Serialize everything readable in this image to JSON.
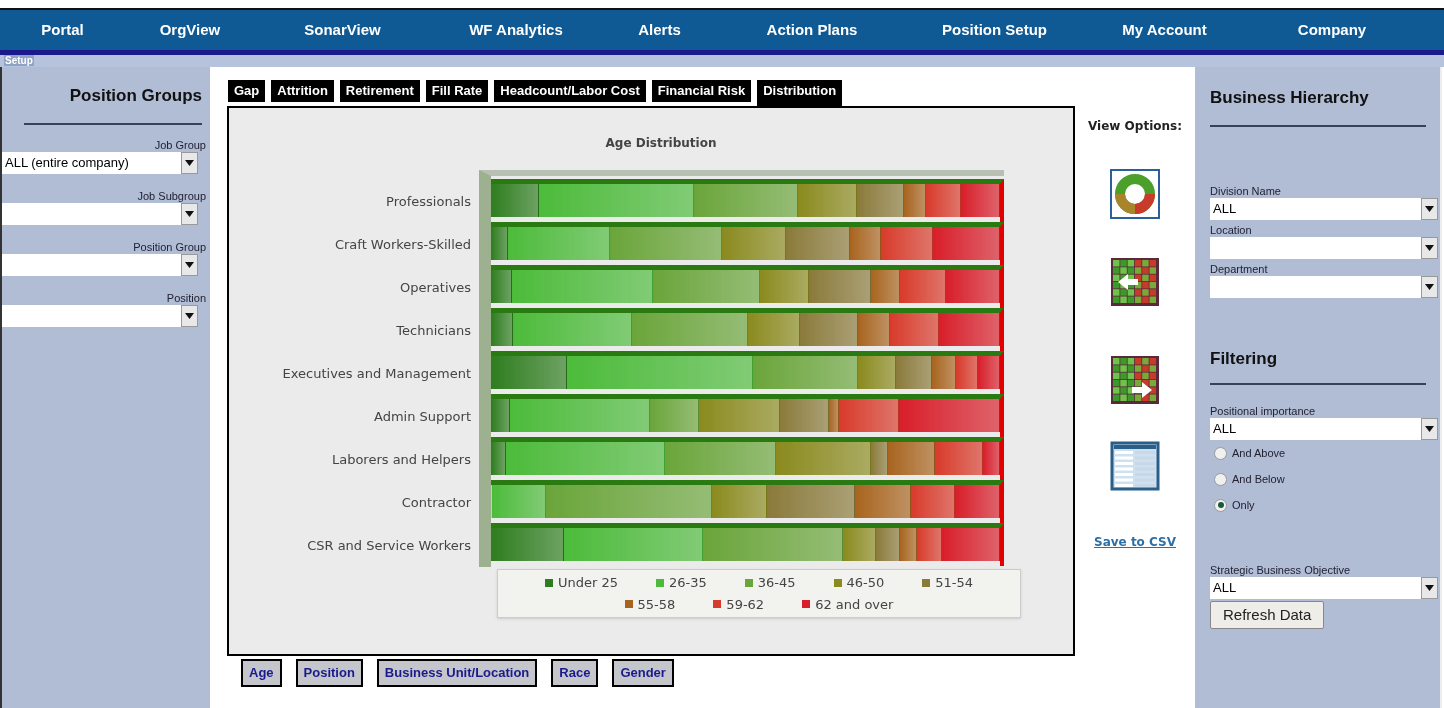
{
  "nav": {
    "items": [
      {
        "label": "Portal"
      },
      {
        "label": "OrgView"
      },
      {
        "label": "SonarView"
      },
      {
        "label": "WF Analytics"
      },
      {
        "label": "Alerts"
      },
      {
        "label": "Action Plans"
      },
      {
        "label": "Position Setup"
      },
      {
        "label": "My Account"
      },
      {
        "label": "Company"
      }
    ],
    "overflow_text": "Setup"
  },
  "position_groups": {
    "title": "Position Groups",
    "fields": [
      {
        "label": "Job Group",
        "value": "ALL (entire company)"
      },
      {
        "label": "Job Subgroup"
      },
      {
        "label": "Position Group"
      },
      {
        "label": "Position"
      }
    ]
  },
  "tabs": [
    {
      "label": "Gap",
      "selected": false
    },
    {
      "label": "Attrition",
      "selected": false
    },
    {
      "label": "Retirement",
      "selected": false
    },
    {
      "label": "Fill Rate",
      "selected": false
    },
    {
      "label": "Headcount/Labor Cost",
      "selected": false
    },
    {
      "label": "Financial Risk",
      "selected": false
    },
    {
      "label": "Distribution",
      "selected": true
    }
  ],
  "chart": {
    "title": "Age Distribution",
    "categories": [
      "Professionals",
      "Craft Workers-Skilled",
      "Operatives",
      "Technicians",
      "Executives and Management",
      "Admin Support",
      "Laborers and Helpers",
      "Contractor",
      "CSR and Service Workers"
    ],
    "legend": [
      {
        "label": "Under 25",
        "color": "#2e7d1e"
      },
      {
        "label": "26-35",
        "color": "#4cbb3a"
      },
      {
        "label": "36-45",
        "color": "#6aa53a"
      },
      {
        "label": "46-50",
        "color": "#8a8a1e"
      },
      {
        "label": "51-54",
        "color": "#8a7a3a"
      },
      {
        "label": "55-58",
        "color": "#a8641e"
      },
      {
        "label": "59-62",
        "color": "#d83a2a"
      },
      {
        "label": "62 and over",
        "color": "#d81e2a"
      }
    ]
  },
  "sub_tabs": [
    {
      "label": "Age"
    },
    {
      "label": "Position"
    },
    {
      "label": "Business Unit/Location"
    },
    {
      "label": "Race"
    },
    {
      "label": "Gender"
    }
  ],
  "view_options": {
    "title": "View Options:",
    "save_link": "Save to CSV"
  },
  "business_hierarchy": {
    "title": "Business Hierarchy",
    "fields": [
      {
        "label": "Division Name",
        "value": "ALL"
      },
      {
        "label": "Location"
      },
      {
        "label": "Department"
      }
    ]
  },
  "filtering": {
    "title": "Filtering",
    "importance_label": "Positional importance",
    "importance_value": "ALL",
    "radios": [
      {
        "label": "And Above",
        "selected": false
      },
      {
        "label": "And Below",
        "selected": false
      },
      {
        "label": "Only",
        "selected": true
      }
    ],
    "objective_label": "Strategic Business Objective",
    "objective_value": "ALL",
    "refresh_button": "Refresh Data"
  }
}
